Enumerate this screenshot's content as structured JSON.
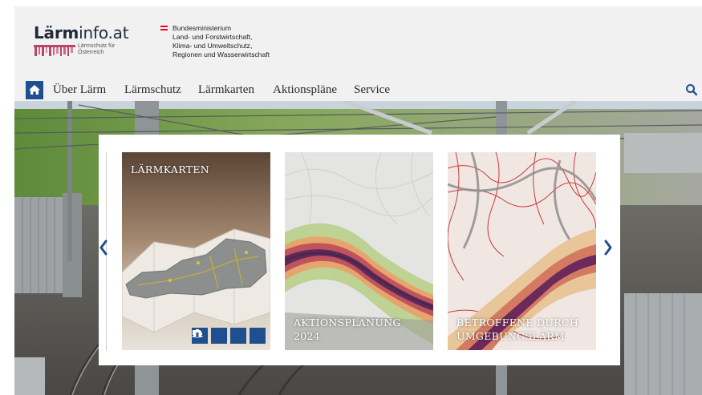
{
  "header": {
    "logo": {
      "text_bold": "Lärm",
      "text_regular": "info.at",
      "tagline_line1": "Lärmschutz für",
      "tagline_line2": "Österreich"
    },
    "ministry": {
      "line1": "Bundesministerium",
      "line2": "Land- und Forstwirtschaft,",
      "line3": "Klima- und Umweltschutz,",
      "line4": "Regionen und Wasserwirtschaft"
    }
  },
  "nav": {
    "home_icon": "home-icon",
    "items": [
      {
        "label": "Über Lärm"
      },
      {
        "label": "Lärmschutz"
      },
      {
        "label": "Lärmkarten"
      },
      {
        "label": "Aktionspläne"
      },
      {
        "label": "Service"
      }
    ],
    "search_icon": "search-icon"
  },
  "slider": {
    "prev_icon": "chevron-left-icon",
    "next_icon": "chevron-right-icon",
    "cards": [
      {
        "title": "LÄRMKARTEN",
        "subtitle": "",
        "icons": [
          "car-icon",
          "train-icon",
          "airplane-icon",
          "factory-icon"
        ]
      },
      {
        "title": "AKTIONSPLANUNG",
        "subtitle": "2024"
      },
      {
        "title": "BETROFFENE DURCH",
        "subtitle": "UMGEBUNGSLÄRM"
      }
    ]
  },
  "colors": {
    "brand_blue": "#1f4f8e",
    "header_bg": "#f1f1f1",
    "flag_red": "#e3001b"
  }
}
